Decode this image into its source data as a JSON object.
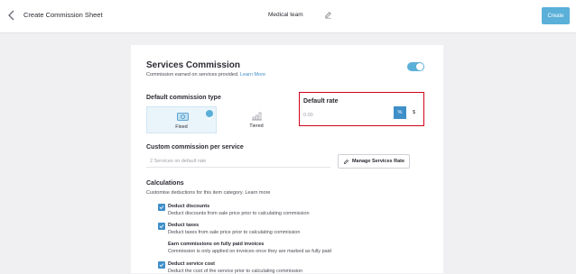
{
  "header": {
    "title": "Create Commission Sheet",
    "team_name": "Medical team",
    "create_label": "Create"
  },
  "services": {
    "heading": "Services Commission",
    "subtitle": "Commission earned on services provided.",
    "learn_more": "Learn More",
    "toggle_on": true
  },
  "commission_type": {
    "label": "Default commission type",
    "options": [
      {
        "label": "Fixed",
        "selected": true
      },
      {
        "label": "Tiered",
        "selected": false
      }
    ]
  },
  "default_rate": {
    "label": "Default rate",
    "placeholder": "0.00",
    "percent_label": "%",
    "dollar_label": "$"
  },
  "custom": {
    "label": "Custom commission per service",
    "input_text": "2 Services on default rate",
    "manage_label": "Manage Services Rate"
  },
  "calculations": {
    "label": "Calculations",
    "subtitle": "Customise deductions for this item category. Learn more",
    "items": [
      {
        "title": "Deduct discounts",
        "desc": "Deduct discounts from sale price prior to calculating commission",
        "checked": true
      },
      {
        "title": "Deduct taxes",
        "desc": "Deduct taxes from sale price prior to calculating commission",
        "checked": true
      },
      {
        "title": "Earn commissions on fully paid invoices",
        "desc": "Commission is only applied on invoices once they are marked as fully paid",
        "checked": false
      },
      {
        "title": "Deduct service cost",
        "desc": "Deduct the cost of the service prior to calculating commission",
        "checked": true
      }
    ]
  },
  "colors": {
    "accent": "#5ab0d8",
    "primary": "#3f8fc9",
    "highlight_border": "#d0021b"
  }
}
